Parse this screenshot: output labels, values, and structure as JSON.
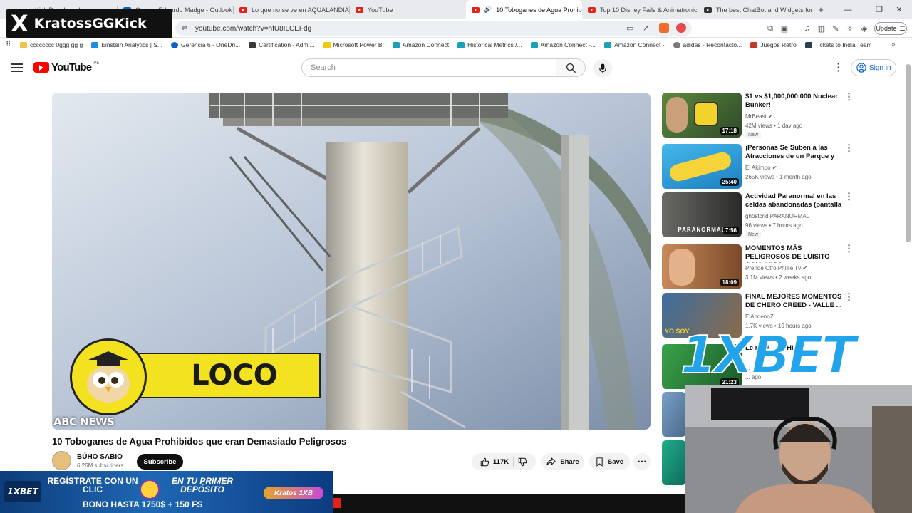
{
  "browser": {
    "tabs": [
      {
        "title": "n - Kick Dashboard",
        "active": false
      },
      {
        "title": "Correo: Eduardo Madge - Outlook",
        "active": false
      },
      {
        "title": "Lo que no se ve en AQUALANDIA | A",
        "active": false
      },
      {
        "title": "YouTube",
        "active": false
      },
      {
        "title": "10 Toboganes de Agua Prohib",
        "active": true
      },
      {
        "title": "Top 10 Disney Fails & Animatronic M",
        "active": false
      },
      {
        "title": "The best ChatBot and Widgets for K",
        "active": false
      }
    ],
    "new_tab_label": "+",
    "url": "youtube.com/watch?v=hfU8ILCEFdg",
    "update_label": "Update",
    "bookmarks": [
      {
        "label": "cccccccc 0ggg gg  g",
        "color": "#f0c24a"
      },
      {
        "label": "Einstein Analytics | S...",
        "color": "#1a8fe3"
      },
      {
        "label": "Gerencia 6 - OneDri...",
        "color": "#0a64c8"
      },
      {
        "label": "Certification - Admi...",
        "color": "#3a3a3a"
      },
      {
        "label": "Microsoft Power BI",
        "color": "#f2c811"
      },
      {
        "label": "Amazon Connect",
        "color": "#1aa1b8"
      },
      {
        "label": "Historical Metrics /...",
        "color": "#1aa1b8"
      },
      {
        "label": "Amazon Connect -...",
        "color": "#1aa1b8"
      },
      {
        "label": "Amazon Connect -",
        "color": "#1aa1b8"
      },
      {
        "label": "adidas - Recontacto...",
        "color": "#777777"
      },
      {
        "label": "Juegos Retro",
        "color": "#c0392b"
      },
      {
        "label": "Tickets to India Team",
        "color": "#2c3e50"
      }
    ]
  },
  "youtube": {
    "logo_text": "YouTube",
    "logo_region": "PE",
    "search_placeholder": "Search",
    "signin_label": "Sign in",
    "video": {
      "overlay_badge": "LOCO",
      "watermark": "ABC NEWS",
      "title": "10 Toboganes de Agua Prohibidos que eran Demasiado Peligrosos",
      "channel_name": "BÚHO SABIO",
      "subscribers": "6.26M subscribers",
      "subscribe_label": "Subscribe",
      "likes": "117K",
      "share_label": "Share",
      "save_label": "Save"
    },
    "recommendations": [
      {
        "title": "$1 vs $1,000,000,000 Nuclear Bunker!",
        "channel": "MrBeast",
        "verified": true,
        "meta": "42M views • 1 day ago",
        "duration": "17:18",
        "new": "New",
        "thumb": "#2f6a2c"
      },
      {
        "title": "¡Personas Se Suben a las Atracciones de un Parque y Se...",
        "channel": "El Akimbo",
        "verified": true,
        "meta": "265K views • 1 month ago",
        "duration": "25:40",
        "new": "",
        "thumb": "#2fa6d9"
      },
      {
        "title": "Actividad Paranormal en las celdas abandonadas (pantalla ...",
        "channel": "ghostcrid PARANORMAL",
        "verified": false,
        "meta": "96 views • 7 hours ago",
        "duration": "7:56",
        "new": "New",
        "thumb": "#505050"
      },
      {
        "title": "MOMENTOS MÁS PELIGROSOS DE LUISITO COMUNICA",
        "channel": "Prende Otro Phillie Tv",
        "verified": true,
        "meta": "3.1M views • 2 weeks ago",
        "duration": "18:09",
        "new": "",
        "thumb": "#9b5a3a"
      },
      {
        "title": "FINAL MEJORES MOMENTOS DE CHERO CREED - VALLE ...",
        "channel": "ElAndenoZ",
        "verified": false,
        "meta": "1.7K views • 10 hours ago",
        "duration": "",
        "new": "",
        "thumb": "#3a5a7a"
      },
      {
        "title": "Le meti... ROHIB...",
        "channel": "...",
        "verified": false,
        "meta": "... ago",
        "duration": "21:23",
        "new": "",
        "thumb": "#2a8f3a"
      }
    ]
  },
  "overlays": {
    "streamer_logo": "X",
    "streamer_name": "KratossGGKick",
    "brand_big": "1XBET",
    "ad": {
      "brand": "1XBET",
      "line1": "REGÍSTRATE CON UN CLIC",
      "line2": "EN TU PRIMER DEPÓSITO",
      "line3": "BONO HASTA 1750$ + 150 FS",
      "badge": "Kratos 1XB"
    }
  }
}
